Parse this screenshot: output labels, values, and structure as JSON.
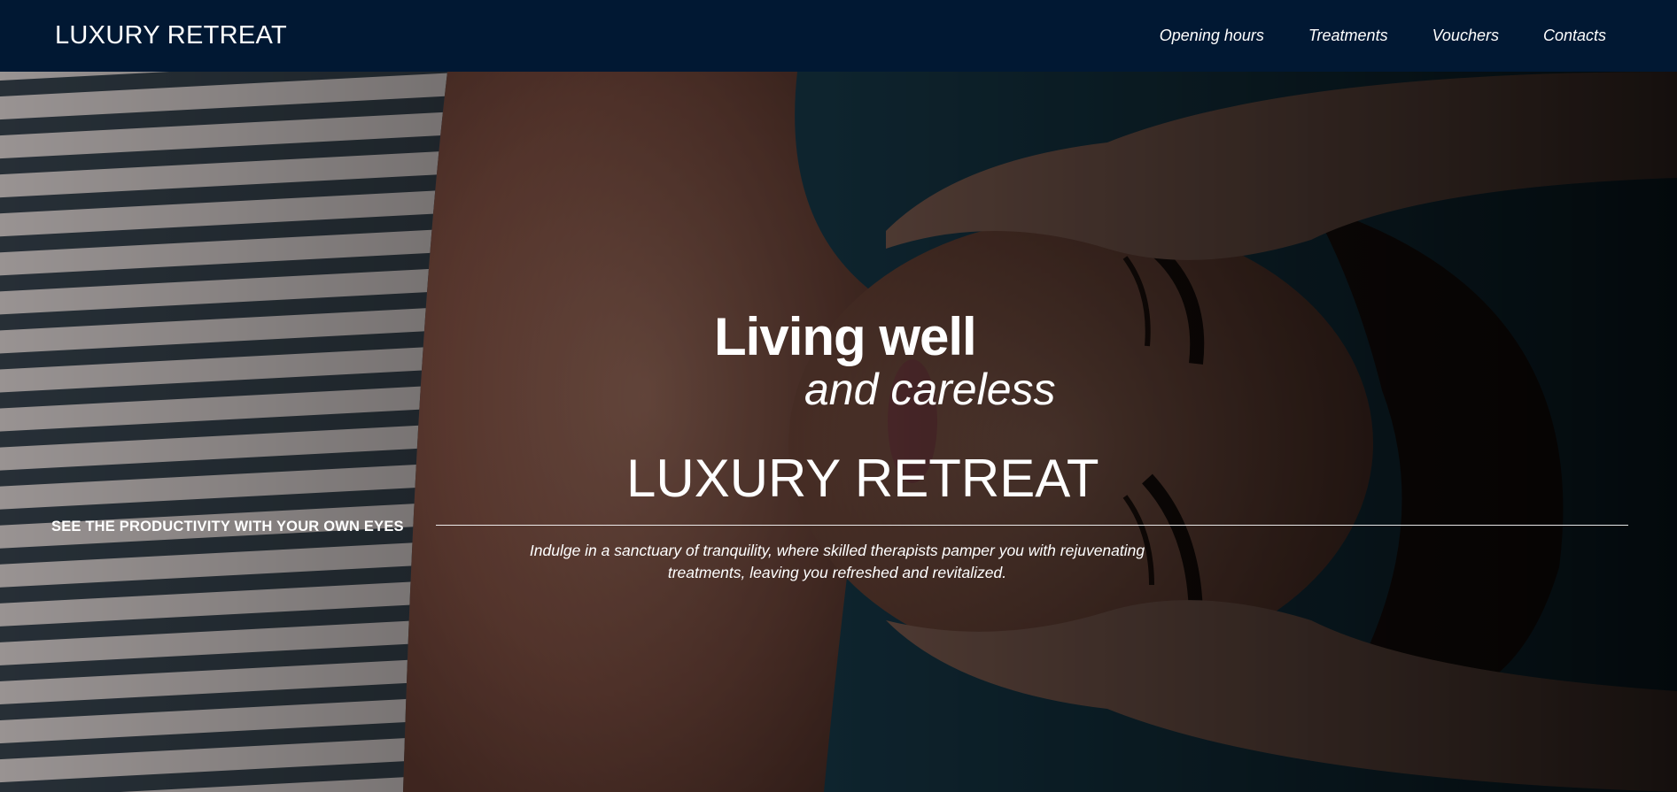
{
  "header": {
    "brand": "LUXURY RETREAT",
    "nav": [
      {
        "label": "Opening hours"
      },
      {
        "label": "Treatments"
      },
      {
        "label": "Vouchers"
      },
      {
        "label": "Contacts"
      }
    ]
  },
  "hero": {
    "headline": "Living well",
    "subheadline": "and careless",
    "brand": "LUXURY RETREAT",
    "cta": "SEE THE PRODUCTIVITY WITH YOUR OWN EYES",
    "description": "Indulge in a sanctuary of tranquility, where skilled therapists pamper you with rejuvenating treatments, leaving you refreshed and revitalized."
  },
  "colors": {
    "navbar_bg": "#011833",
    "text": "#ffffff"
  }
}
